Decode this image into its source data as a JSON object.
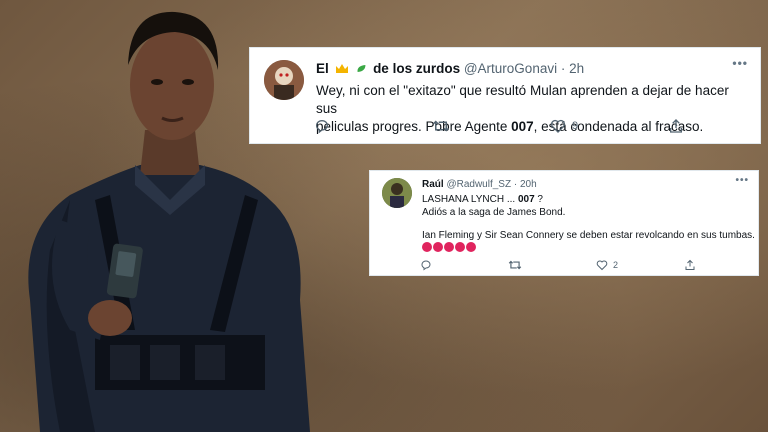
{
  "tweet1": {
    "name_prefix": "El",
    "name_suffix": "de los zurdos",
    "handle": "@ArturoGonavi",
    "separator": "·",
    "time": "2h",
    "text_line1": "Wey, ni con el \"exitazo\" que resultó Mulan aprenden a dejar de hacer sus",
    "text_line2_a": "peliculas progres. Pobre Agente ",
    "text_line2_bold": "007",
    "text_line2_b": ", está condenada al fracaso.",
    "like_count": "9",
    "icons": [
      "reply-icon",
      "retweet-icon",
      "like-icon",
      "share-icon",
      "more-icon"
    ]
  },
  "tweet2": {
    "name": "Raúl",
    "handle": "@Radwulf_SZ",
    "separator": "·",
    "time": "20h",
    "line1_a": "LASHANA LYNCH ... ",
    "line1_bold": "007",
    "line1_b": " ?",
    "line2": "Adiós a la saga de James Bond.",
    "line3": "Ian Fleming y Sir Sean Connery se deben estar revolcando en sus tumbas.",
    "like_count": "2",
    "icons": [
      "reply-icon",
      "retweet-icon",
      "like-icon",
      "share-icon",
      "more-icon"
    ]
  },
  "colors": {
    "accent_icon": "#1d9bf0",
    "text_muted": "#536471",
    "angry_emoji": "#e0245e"
  }
}
